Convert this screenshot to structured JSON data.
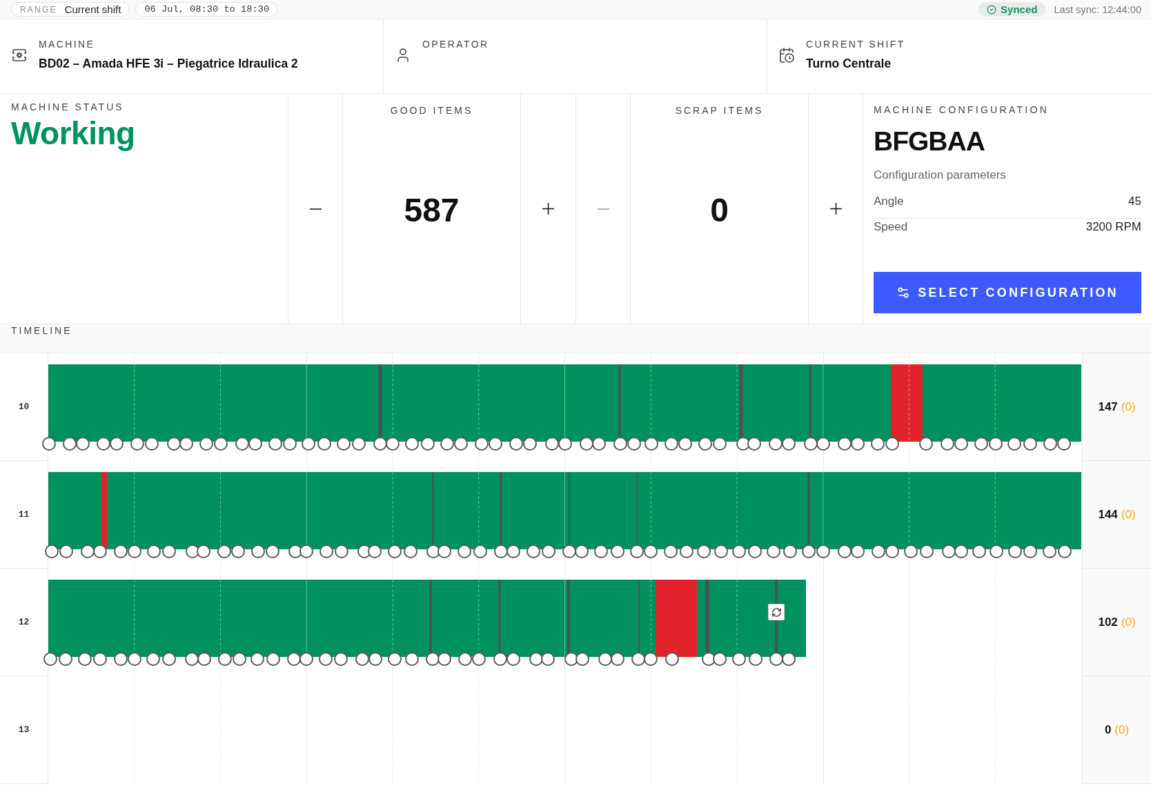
{
  "top_bar": {
    "range": {
      "label": "RANGE",
      "value": "Current shift"
    },
    "period": "06 Jul, 08:30 to 18:30",
    "sync": {
      "status": "Synced",
      "last_sync": "Last sync: 12:44:00"
    }
  },
  "info_cards": [
    {
      "kind": "machine",
      "label": "MACHINE",
      "value": "BD02 – Amada HFE 3i – Piegatrice Idraulica 2"
    },
    {
      "kind": "operator",
      "label": "OPERATOR"
    },
    {
      "kind": "shift",
      "label": "CURRENT SHIFT",
      "value": "Turno Centrale"
    }
  ],
  "machine_status": {
    "label": "MACHINE STATUS",
    "value": "Working"
  },
  "counters": [
    {
      "label": "GOOD ITEMS",
      "value": "587",
      "decrease": {
        "disabled": false
      },
      "increase": {
        "disabled": false
      }
    },
    {
      "label": "SCRAP ITEMS",
      "value": "0",
      "decrease": {
        "disabled": true
      },
      "increase": {
        "disabled": false
      }
    }
  ],
  "configuration": {
    "label": "MACHINE CONFIGURATION",
    "code": "BFGBAA",
    "parameters_title": "Configuration parameters",
    "parameters": [
      {
        "name": "Angle",
        "value": "45"
      },
      {
        "name": "Speed",
        "value": "3200 RPM"
      }
    ],
    "button": "SELECT CONFIGURATION"
  },
  "timeline": {
    "title": "TIMELINE",
    "rows": [
      {
        "hour": "10",
        "good": "147",
        "scrap": "(0)"
      },
      {
        "hour": "11",
        "good": "144",
        "scrap": "(0)"
      },
      {
        "hour": "12",
        "good": "102",
        "scrap": "(0)"
      },
      {
        "hour": "13",
        "good": "0",
        "scrap": "(0)"
      }
    ]
  }
}
